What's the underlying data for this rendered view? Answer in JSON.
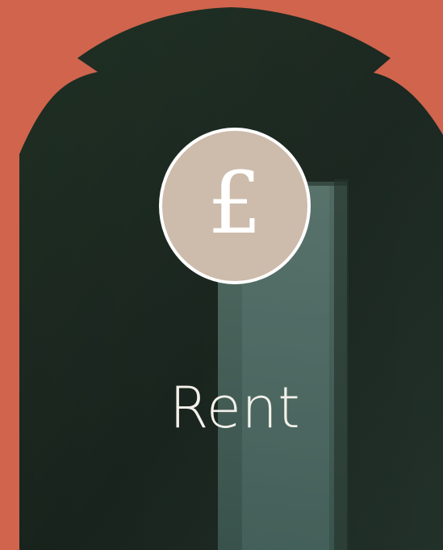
{
  "card": {
    "title": "Rent",
    "icon_glyph": "£"
  },
  "icons": {
    "main_icon": "pound-sterling-icon"
  },
  "colors": {
    "background": "#d0644d",
    "arch": "#1c2a21",
    "badge": "#cdbcab",
    "badge_border": "#ffffff",
    "text": "#f4f1eb"
  }
}
